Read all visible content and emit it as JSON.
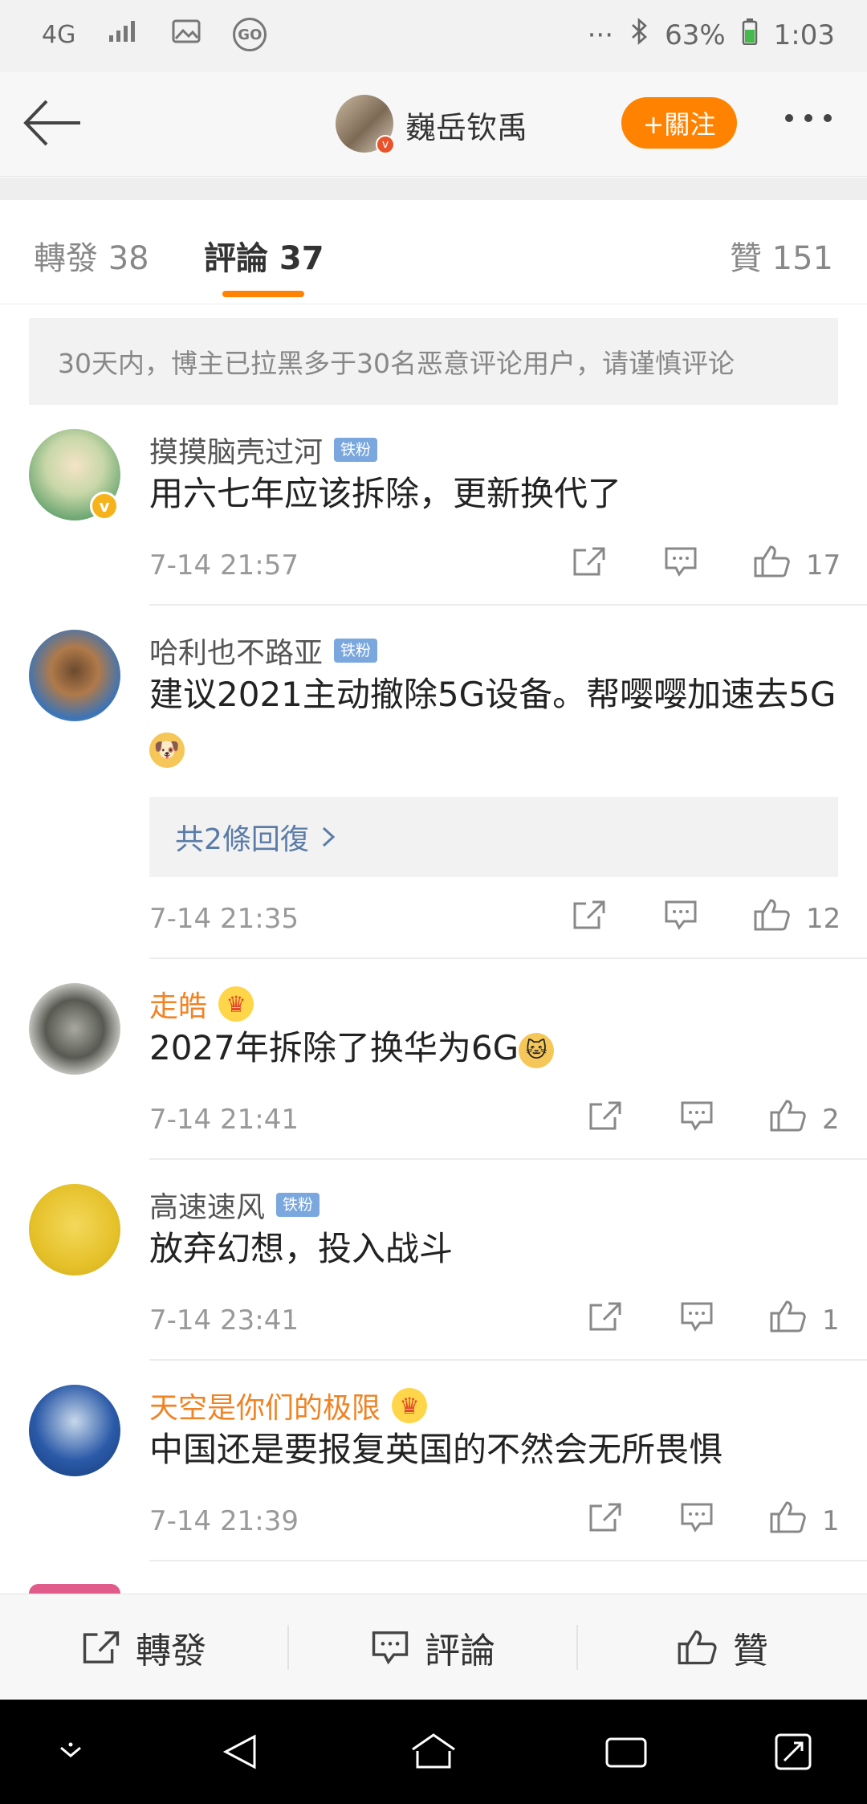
{
  "status_bar": {
    "network": "4G",
    "battery": "63%",
    "time": "1:03",
    "more": "···"
  },
  "header": {
    "username": "巍岳钦禹",
    "follow_label": "+關注"
  },
  "tabs": [
    {
      "label": "轉發 38"
    },
    {
      "label": "評論 37"
    },
    {
      "label": "贊 151"
    }
  ],
  "notice": "30天内，博主已拉黑多于30名恶意评论用户，请谨慎评论",
  "comments": [
    {
      "name": "摸摸脑壳过河",
      "badge": "铁粉",
      "text": "用六七年应该拆除，更新换代了",
      "time": "7-14 21:57",
      "likes": "17"
    },
    {
      "name": "哈利也不路亚",
      "badge": "铁粉",
      "text": "建议2021主动撤除5G设备。帮嘤嘤加速去5G",
      "replies": "共2條回復",
      "time": "7-14 21:35",
      "likes": "12"
    },
    {
      "name": "走皓",
      "text": "2027年拆除了换华为6G",
      "time": "7-14 21:41",
      "likes": "2"
    },
    {
      "name": "高速速风",
      "badge": "铁粉",
      "text": "放弃幻想，投入战斗",
      "time": "7-14 23:41",
      "likes": "1"
    },
    {
      "name": "天空是你们的极限",
      "text": "中国还是要报复英国的不然会无所畏惧",
      "time": "7-14 21:39",
      "likes": "1"
    }
  ],
  "bottom_bar": {
    "repost": "轉發",
    "comment": "評論",
    "like": "贊"
  },
  "colors": {
    "accent": "#ff8200",
    "vip_name": "#f08324",
    "link": "#5b7ca8"
  }
}
